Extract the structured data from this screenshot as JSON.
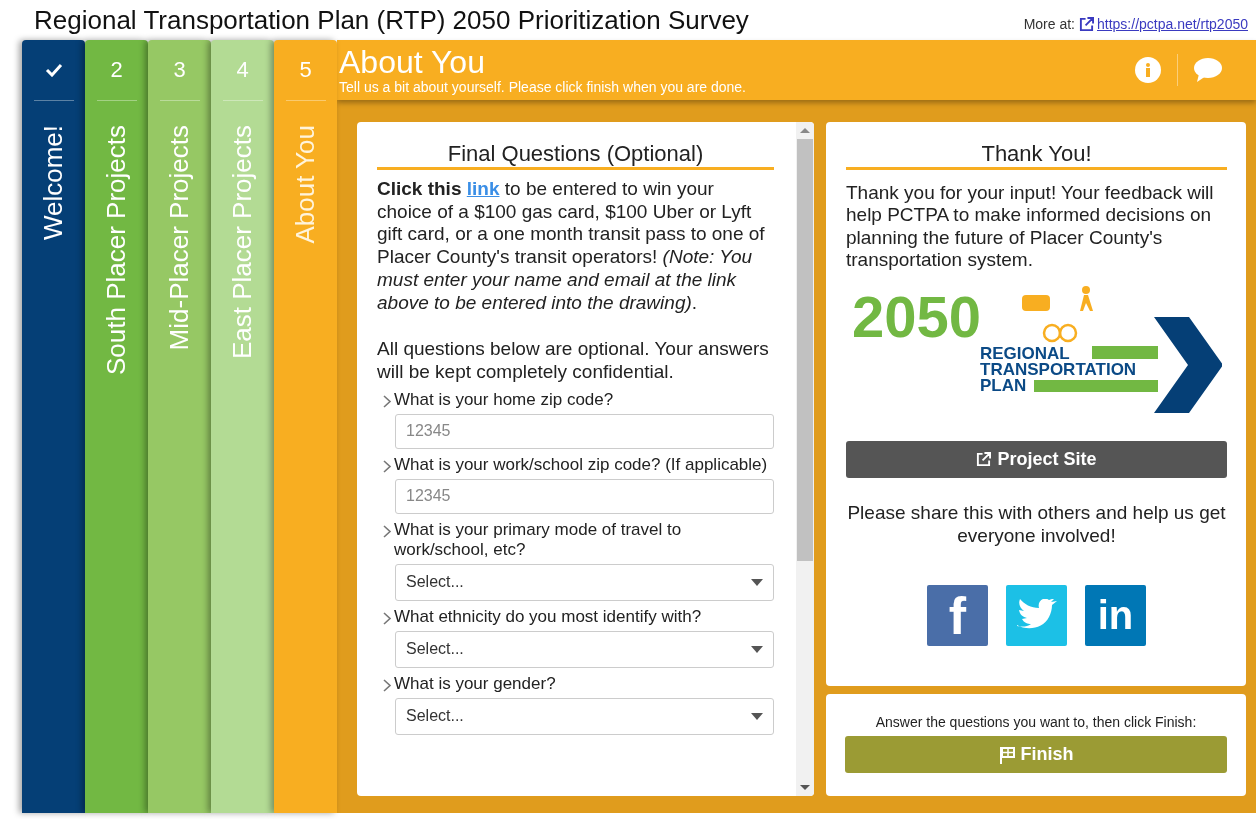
{
  "header": {
    "title": "Regional Transportation Plan (RTP) 2050 Prioritization Survey",
    "more_label": "More at:",
    "more_link": "https://pctpa.net/rtp2050"
  },
  "steps": [
    {
      "label": "Welcome!",
      "completed": true,
      "selected": false,
      "color": "#053f76"
    },
    {
      "number": "2",
      "label": "South Placer Projects",
      "completed": false,
      "selected": false,
      "color": "#72b843"
    },
    {
      "number": "3",
      "label": "Mid-Placer Projects",
      "completed": false,
      "selected": false,
      "color": "#96c864"
    },
    {
      "number": "4",
      "label": "East Placer Projects",
      "completed": false,
      "selected": false,
      "color": "#b3db94"
    },
    {
      "number": "5",
      "label": "About You",
      "completed": false,
      "selected": true,
      "color": "#f8ae21"
    }
  ],
  "panel": {
    "title": "About You",
    "subtitle": "Tell us a bit about yourself. Please click finish when you are done."
  },
  "form": {
    "heading": "Final Questions (Optional)",
    "intro": {
      "lead": "Click this",
      "link": "link",
      "rest": "to be entered to win your choice of a $100 gas card, $100 Uber or Lyft gift card, or a one month transit pass to one of Placer County's transit operators! *(Note: You must enter your name and email at the link above to be entered into the drawing)*."
    },
    "note": "All questions below are optional. Your answers will be kept completely confidential.",
    "questions": [
      {
        "kind": "text",
        "label": "What is your home zip code?",
        "placeholder": "12345"
      },
      {
        "kind": "text",
        "label": "What is your work/school zip code? (If applicable)",
        "placeholder": "12345"
      },
      {
        "kind": "select",
        "label": "What is your primary mode of travel to work/school, etc?",
        "value": "Select..."
      },
      {
        "kind": "select",
        "label": "What ethnicity do you most identify with?",
        "value": "Select..."
      },
      {
        "kind": "select",
        "label": "What is your gender?",
        "value": "Select..."
      }
    ]
  },
  "thanks": {
    "heading": "Thank You!",
    "text": "Thank you for your input! Your feedback will help PCTPA to make informed decisions on planning the future of Placer County's transportation system.",
    "logo": {
      "year": "2050",
      "lines": [
        "REGIONAL",
        "TRANSPORTATION",
        "PLAN"
      ]
    },
    "project_button": "Project Site",
    "share_text": "Please share this with others and help us get everyone involved!",
    "social": [
      {
        "kind": "facebook",
        "glyph": "f",
        "color": "#4a6ea8"
      },
      {
        "kind": "twitter",
        "color": "#1cc0e6"
      },
      {
        "kind": "linkedin",
        "glyph": "in",
        "color": "#0077b5"
      }
    ]
  },
  "finish": {
    "hint": "Answer the questions you want to, then click Finish:",
    "button": "Finish"
  }
}
